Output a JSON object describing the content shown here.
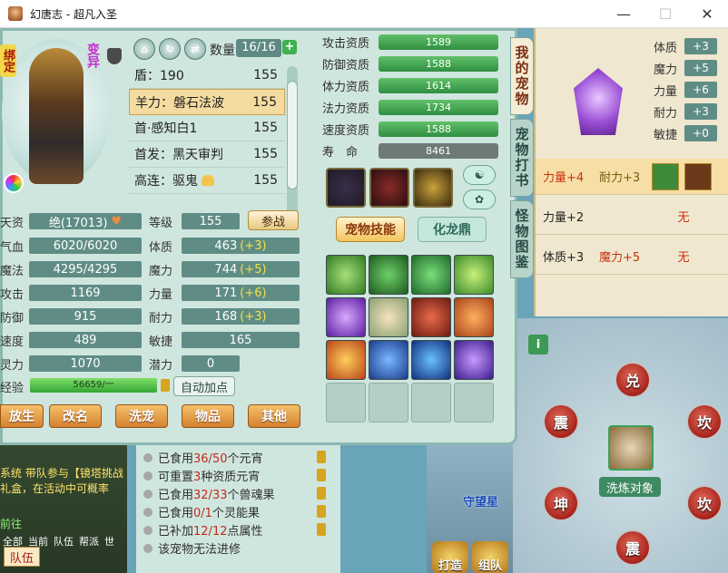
{
  "window": {
    "title": "幻唐志 - 超凡入圣",
    "min": "—",
    "max": "☐",
    "close": "✕"
  },
  "portrait": {
    "tag_left": "绑定",
    "tag_right": "变异"
  },
  "count": {
    "label": "数量",
    "value": "16/16",
    "plus": "+"
  },
  "pets": [
    {
      "name": "盾：190",
      "level": "155",
      "selected": false
    },
    {
      "name": "羊力：磐石法波",
      "level": "155",
      "selected": true
    },
    {
      "name": "首·感知白1",
      "level": "155",
      "selected": false
    },
    {
      "name": "首发：黑天审判",
      "level": "155",
      "selected": false
    },
    {
      "name": "高连：驱鬼",
      "level": "155",
      "selected": false
    }
  ],
  "stats": {
    "tianzi": {
      "label": "天资",
      "value": "绝(17013)"
    },
    "level": {
      "label": "等级",
      "value": "155"
    },
    "fight_btn": "参战",
    "rows": [
      {
        "l": "气血",
        "v": "6020/6020",
        "l2": "体质",
        "v2": "463",
        "b": "(+3)"
      },
      {
        "l": "魔法",
        "v": "4295/4295",
        "l2": "魔力",
        "v2": "744",
        "b": "(+5)"
      },
      {
        "l": "攻击",
        "v": "1169",
        "l2": "力量",
        "v2": "171",
        "b": "(+6)"
      },
      {
        "l": "防御",
        "v": "915",
        "l2": "耐力",
        "v2": "168",
        "b": "(+3)"
      },
      {
        "l": "速度",
        "v": "489",
        "l2": "敏捷",
        "v2": "165",
        "b": ""
      },
      {
        "l": "灵力",
        "v": "1070",
        "l2": "潜力",
        "v2": "0",
        "b": ""
      }
    ],
    "exp_label": "经验",
    "exp_value": "56659/一",
    "exp_fill": 1.0,
    "auto_btn": "自动加点"
  },
  "bottom_buttons": [
    "放生",
    "改名",
    "洗宠",
    "物品",
    "其他"
  ],
  "aptitude": [
    {
      "label": "攻击资质",
      "value": "1589"
    },
    {
      "label": "防御资质",
      "value": "1588"
    },
    {
      "label": "体力资质",
      "value": "1614"
    },
    {
      "label": "法力资质",
      "value": "1734"
    },
    {
      "label": "速度资质",
      "value": "1588"
    },
    {
      "label": "寿　命",
      "value": "8461"
    }
  ],
  "skill_tabs": {
    "skills": "宠物技能",
    "dragon": "化龙鼎"
  },
  "side_tabs": [
    "我的宠物",
    "宠物打书",
    "怪物图鉴"
  ],
  "right_attrs": [
    {
      "label": "体质",
      "value": "+3"
    },
    {
      "label": "魔力",
      "value": "+5"
    },
    {
      "label": "力量",
      "value": "+6"
    },
    {
      "label": "耐力",
      "value": "+3"
    },
    {
      "label": "敏捷",
      "value": "+0"
    }
  ],
  "right_rows": [
    {
      "a": "力量+4",
      "b": "耐力+3",
      "c": ""
    },
    {
      "a": "力量+2",
      "b": "",
      "c": "无"
    },
    {
      "a": "体质+3",
      "b": "魔力+5",
      "c": "无"
    }
  ],
  "info_lines": [
    {
      "pre": "已食用",
      "hl": "36/50",
      "post": "个元宵"
    },
    {
      "pre": "可重置",
      "hl": "3",
      "post": "种资质元宵"
    },
    {
      "pre": "已食用",
      "hl": "32/33",
      "post": "个兽魂果"
    },
    {
      "pre": "已食用",
      "hl": "0/1",
      "post": "个灵能果"
    },
    {
      "pre": "已补加",
      "hl": "12/12",
      "post": "点属性"
    },
    {
      "pre": "该宠物无法进修",
      "hl": "",
      "post": ""
    }
  ],
  "chat": {
    "lines": [
      "系统 带队参与【镜塔挑战",
      "礼盒，在活动中可概率",
      "前往"
    ],
    "tabs": [
      "全部",
      "当前",
      "队伍",
      "帮派",
      "世"
    ],
    "team": "队伍"
  },
  "bagua": [
    "兑",
    "震",
    "坎",
    "坤",
    "坎",
    "震"
  ],
  "refine": "洗炼对象",
  "info_icon": "i",
  "map_label": "守望星",
  "game_buttons": [
    "打造",
    "组队"
  ]
}
